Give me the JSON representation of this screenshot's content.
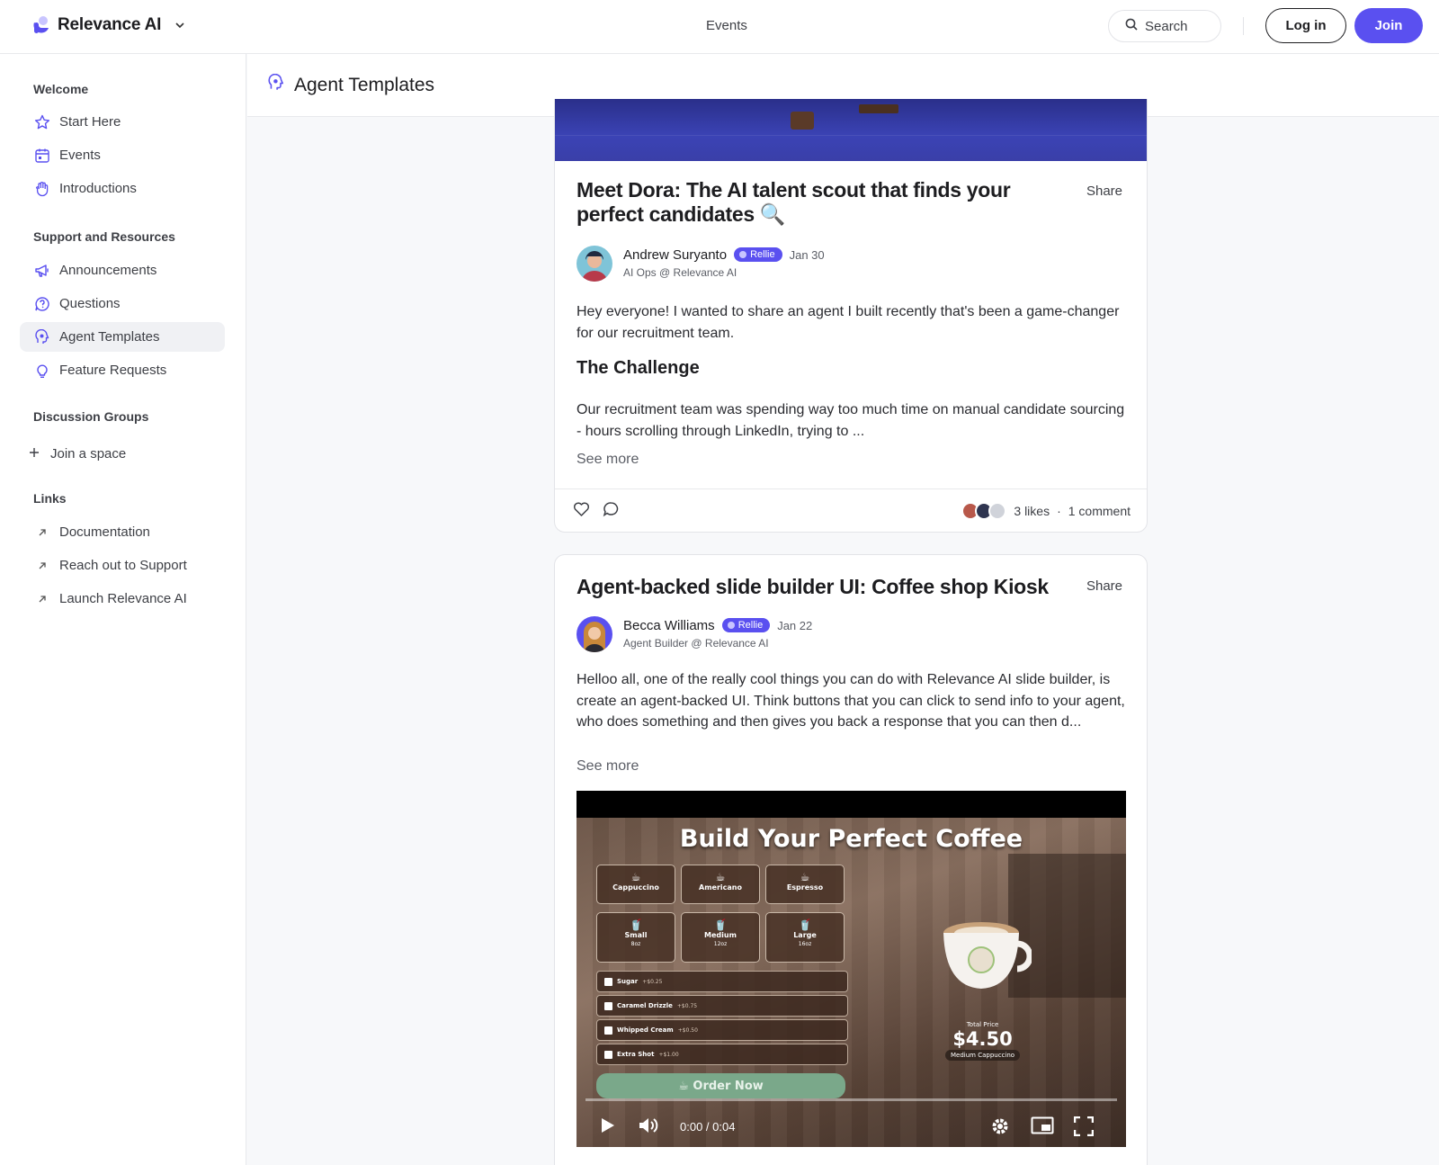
{
  "header": {
    "brand": "Relevance AI",
    "nav_events": "Events",
    "search_label": "Search",
    "login_label": "Log in",
    "join_label": "Join"
  },
  "sidebar": {
    "sections": [
      {
        "title": "Welcome",
        "items": [
          "Start Here",
          "Events",
          "Introductions"
        ]
      },
      {
        "title": "Support and Resources",
        "items": [
          "Announcements",
          "Questions",
          "Agent Templates",
          "Feature Requests"
        ]
      },
      {
        "title": "Discussion Groups",
        "items": [
          "Join a space"
        ]
      },
      {
        "title": "Links",
        "items": [
          "Documentation",
          "Reach out to Support",
          "Launch Relevance AI"
        ]
      }
    ],
    "active_item": "Agent Templates"
  },
  "page": {
    "title": "Agent Templates"
  },
  "posts": [
    {
      "title": "Meet Dora: The AI talent scout that finds your perfect candidates 🔍",
      "share": "Share",
      "author": "Andrew Suryanto",
      "badge": "Rellie",
      "date": "Jan 30",
      "role": "AI Ops @ Relevance AI",
      "intro": "Hey everyone! I wanted to share an agent I built recently that's been a game-changer for our recruitment team.",
      "heading": "The Challenge",
      "excerpt": "Our recruitment team was spending way too much time on manual candidate sourcing - hours scrolling through LinkedIn, trying to ...",
      "see_more": "See more",
      "likes": "3 likes",
      "separator": "·",
      "comments": "1 comment"
    },
    {
      "title": "Agent-backed slide builder UI: Coffee shop Kiosk",
      "share": "Share",
      "author": "Becca Williams",
      "badge": "Rellie",
      "date": "Jan 22",
      "role": "Agent Builder @ Relevance AI",
      "excerpt": "Helloo all, one of the really cool things you can do with Relevance AI slide builder, is create an agent-backed UI. Think buttons that you can click to send info to your agent, who does something and then gives you back a response that you can then d...",
      "see_more": "See more",
      "video": {
        "title": "Build Your Perfect Coffee",
        "drinks": [
          "Cappuccino",
          "Americano",
          "Espresso"
        ],
        "sizes": [
          {
            "name": "Small",
            "sub": "8oz"
          },
          {
            "name": "Medium",
            "sub": "12oz"
          },
          {
            "name": "Large",
            "sub": "16oz"
          }
        ],
        "addons": [
          {
            "name": "Sugar",
            "price": "+$0.25"
          },
          {
            "name": "Caramel Drizzle",
            "price": "+$0.75"
          },
          {
            "name": "Whipped Cream",
            "price": "+$0.50"
          },
          {
            "name": "Extra Shot",
            "price": "+$1.00"
          }
        ],
        "order_label": "☕ Order Now",
        "total_label": "Total Price",
        "total_value": "$4.50",
        "total_sub": "Medium Cappuccino",
        "time": "0:00 / 0:04"
      }
    }
  ],
  "colors": {
    "accent": "#5a50f0",
    "border": "#e3e4e8"
  }
}
